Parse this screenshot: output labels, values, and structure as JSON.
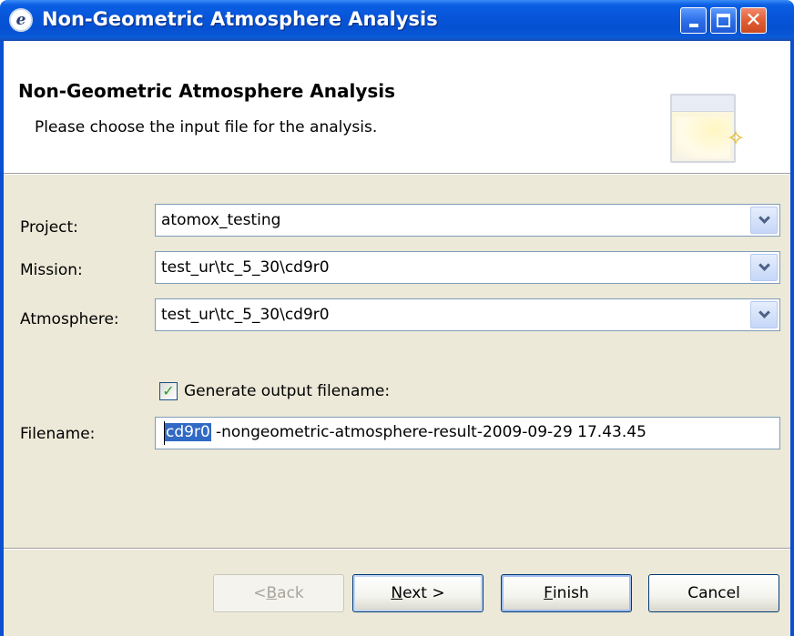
{
  "window": {
    "title": "Non-Geometric Atmosphere Analysis",
    "app_icon_glyph": "e"
  },
  "header": {
    "title": "Non-Geometric Atmosphere Analysis",
    "description": "Please choose the input file for the analysis."
  },
  "form": {
    "project": {
      "label": "Project:",
      "value": "atomox_testing"
    },
    "mission": {
      "label": "Mission:",
      "value": "test_ur\\tc_5_30\\cd9r0"
    },
    "atmosphere": {
      "label": "Atmosphere:",
      "value": "test_ur\\tc_5_30\\cd9r0"
    },
    "generate_output": {
      "label": "Generate output filename:",
      "checked": true
    },
    "filename": {
      "label": "Filename:",
      "selected_text": "cd9r0",
      "remaining_text": "-nongeometric-atmosphere-result-2009-09-29 17.43.45"
    }
  },
  "buttons": {
    "back": {
      "prefix": "< ",
      "mnemonic": "B",
      "rest": "ack",
      "enabled": false
    },
    "next": {
      "mnemonic": "N",
      "rest": "ext >",
      "enabled": true
    },
    "finish": {
      "mnemonic": "F",
      "rest": "inish",
      "enabled": true
    },
    "cancel": {
      "label": "Cancel",
      "enabled": true
    }
  },
  "icons": {
    "minimize": "minimize-icon",
    "maximize": "maximize-icon",
    "close": "close-icon",
    "dropdown": "chevron-down-icon",
    "check": "checkmark-icon"
  },
  "colors": {
    "titlebar": "#0754d8",
    "close_button": "#e35d33",
    "selection": "#316ac5",
    "check": "#21a121",
    "dialog_bg": "#ece9d8"
  }
}
